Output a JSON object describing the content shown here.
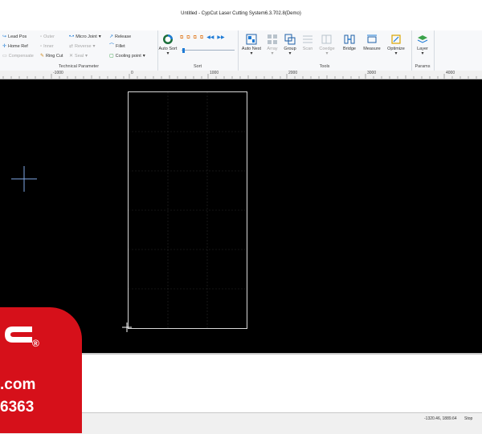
{
  "window": {
    "title": "Untitled - CypCut Laser Cutting System6.3.702.8(Demo)"
  },
  "ribbon": {
    "technical": {
      "label": "Technical Parameter",
      "lead_pos": "Lead Pos",
      "home_ref": "Home Ref",
      "compensate": "Compensate",
      "outer": "Outer",
      "inner": "Inner",
      "ring_cut": "Ring Cut",
      "micro_joint": "Micro Joint",
      "reverse": "Reverse",
      "seal": "Seal",
      "release": "Release",
      "fillet": "Fillet",
      "cooling_point": "Cooling point"
    },
    "sort": {
      "label": "Sort",
      "auto_sort": "Auto Sort"
    },
    "tools": {
      "label": "Tools",
      "auto_nest": "Auto Nest",
      "array": "Array",
      "group": "Group",
      "scan": "Scan",
      "coedge": "Coedge",
      "bridge": "Bridge",
      "measure": "Measure",
      "optimize": "Optimize"
    },
    "params": {
      "label": "Params",
      "layer": "Layer"
    }
  },
  "ruler": {
    "labels": [
      "-1000",
      "0",
      "1000",
      "2000",
      "3000",
      "4000"
    ]
  },
  "status": {
    "coords": "-1320.46, 1889.64",
    "state": "Stop"
  },
  "watermark": {
    "registered": "®",
    "website": ".com",
    "phone": "6363"
  },
  "colors": {
    "canvas": "#000000",
    "accent": "#d6101a",
    "ribbon": "#f7f8fa"
  }
}
